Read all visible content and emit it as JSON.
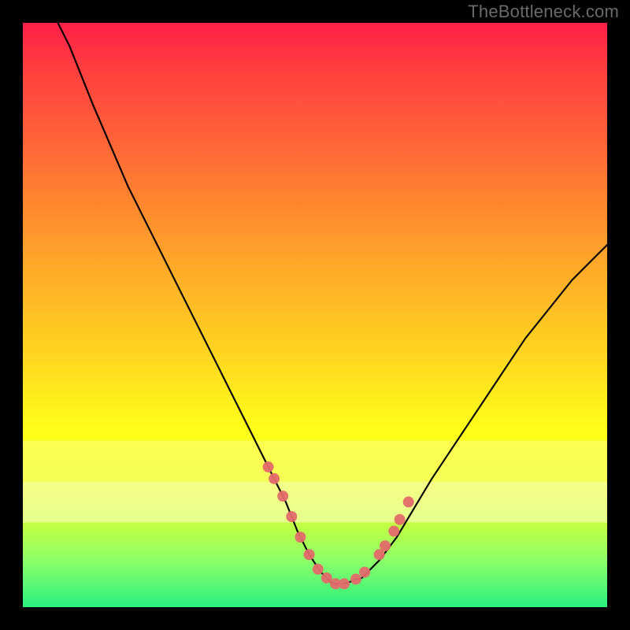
{
  "attribution": "TheBottleneck.com",
  "colors": {
    "frame": "#000000",
    "curve": "#000000",
    "marker": "#e46a6c",
    "gradient_stops": [
      "#ff1f47",
      "#ff3f3f",
      "#ff6338",
      "#ff8a2e",
      "#ffb327",
      "#ffd91f",
      "#ffff19",
      "#eaff28",
      "#c9ff3c",
      "#8dff69",
      "#29f07e"
    ]
  },
  "chart_data": {
    "type": "line",
    "title": "",
    "xlabel": "",
    "ylabel": "",
    "xlim": [
      0,
      100
    ],
    "ylim": [
      0,
      100
    ],
    "grid": false,
    "legend": false,
    "series": [
      {
        "name": "bottleneck-curve",
        "x": [
          6,
          8,
          10,
          12,
          15,
          18,
          21,
          24,
          27,
          30,
          33,
          36,
          39,
          42,
          45,
          47,
          49,
          51,
          53,
          55,
          58,
          61,
          64,
          67,
          70,
          74,
          78,
          82,
          86,
          90,
          94,
          98,
          100
        ],
        "y": [
          100,
          96,
          91,
          86,
          79,
          72,
          66,
          60,
          54,
          48,
          42,
          36,
          30,
          24,
          18,
          13,
          9,
          6,
          4,
          4,
          5,
          8,
          12,
          17,
          22,
          28,
          34,
          40,
          46,
          51,
          56,
          60,
          62
        ]
      }
    ],
    "markers": {
      "name": "highlighted-points",
      "x": [
        42,
        43,
        44.5,
        46,
        47.5,
        49,
        50.5,
        52,
        53.5,
        55,
        57,
        58.5,
        61,
        62,
        63.5,
        64.5,
        66
      ],
      "y": [
        24,
        22,
        19,
        15.5,
        12,
        9,
        6.5,
        5,
        4,
        4,
        4.8,
        6,
        9,
        10.5,
        13,
        15,
        18
      ]
    },
    "bands": [
      {
        "name": "upper-haze",
        "y0": 71.5,
        "y1": 78.5
      },
      {
        "name": "lower-haze",
        "y0": 78.5,
        "y1": 85.5
      }
    ]
  }
}
